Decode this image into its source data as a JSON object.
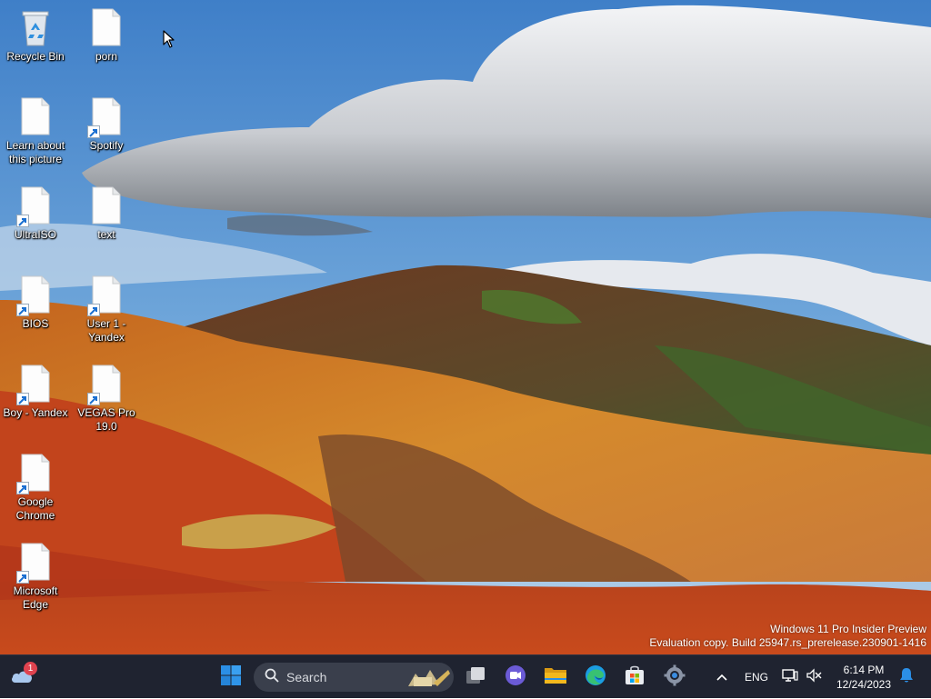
{
  "desktop": {
    "icons": [
      {
        "label": "Recycle Bin"
      },
      {
        "label": "porn"
      },
      {
        "label": "Learn about this picture"
      },
      {
        "label": "Spotify"
      },
      {
        "label": "UltraISO"
      },
      {
        "label": "text"
      },
      {
        "label": "BIOS"
      },
      {
        "label": "User 1 - Yandex"
      },
      {
        "label": "Boy - Yandex"
      },
      {
        "label": "VEGAS Pro 19.0"
      },
      {
        "label": "Google Chrome"
      },
      {
        "label": "Microsoft Edge"
      }
    ]
  },
  "watermark": {
    "line1": "Windows 11 Pro Insider Preview",
    "line2": "Evaluation copy. Build 25947.rs_prerelease.230901-1416"
  },
  "taskbar": {
    "weather_badge": "1",
    "search_placeholder": "Search",
    "pinned": [
      {
        "icon": "start-icon"
      },
      {
        "icon": "search-icon"
      },
      {
        "icon": "task-view-icon"
      },
      {
        "icon": "meet-now-icon"
      },
      {
        "icon": "file-explorer-icon"
      },
      {
        "icon": "edge-icon"
      },
      {
        "icon": "microsoft-store-icon"
      },
      {
        "icon": "settings-icon"
      }
    ],
    "tray": {
      "language": "ENG",
      "time": "6:14 PM",
      "date": "12/24/2023"
    }
  },
  "colors": {
    "taskbar_bg": "#1f2330",
    "start_blue": "#2b8fe6",
    "badge_red": "#e0434f",
    "folder_yellow": "#f2b81e"
  }
}
